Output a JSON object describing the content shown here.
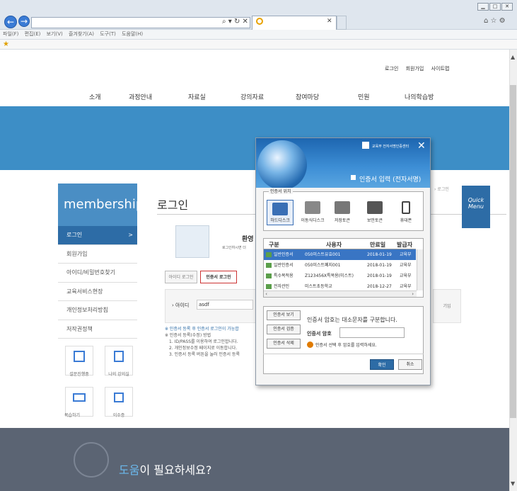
{
  "browser": {
    "menu": [
      "파일(F)",
      "편집(E)",
      "보기(V)",
      "즐겨찾기(A)",
      "도구(T)",
      "도움말(H)"
    ],
    "addr_tools": "⌕ ▾ ↻ ✕"
  },
  "header": {
    "links": [
      "로그인",
      "회원가입",
      "사이트맵"
    ],
    "nav": [
      "소개",
      "과정안내",
      "자료실",
      "강의자료",
      "참여마당",
      "민원",
      "나의학습방"
    ]
  },
  "sidebar": {
    "title": "membership",
    "items": [
      {
        "label": "로그인",
        "arrow": ">"
      },
      {
        "label": "회원가입"
      },
      {
        "label": "아이디/비밀번호찾기"
      },
      {
        "label": "교육서비스현장"
      },
      {
        "label": "개인정보처리방침"
      },
      {
        "label": "저작권정책"
      }
    ],
    "icons": [
      {
        "label": "설문진행중",
        "icon": "survey-icon"
      },
      {
        "label": "나의 강의실",
        "icon": "classroom-icon"
      },
      {
        "label": "복습하기",
        "icon": "review-icon"
      },
      {
        "label": "이수증",
        "icon": "certificate-icon"
      }
    ]
  },
  "main": {
    "title": "로그인",
    "crumb": "› 로그인",
    "welcome": "환영",
    "welcome_sub": "로그인하시면 더",
    "tabs": [
      "아이디 로그인",
      "인증서 로그인"
    ],
    "id_label": "› 아이디",
    "id_value": "asdf",
    "notes_title": "※ 인증서 등록 후 인증서 로그인이 가능합",
    "notes_head": "※ 인증서 등록(수정) 방법",
    "notes": [
      "1. ID/PASS를 이용하여 로그인합니다.",
      "2. 개인정보수정 페이지로 이동합니다.",
      "3. 인증서 등록 버튼을 눌러 인증서 등록"
    ],
    "side_text": "기입"
  },
  "quick": "Quick Menu",
  "help": {
    "highlight": "도움",
    "rest": "이 필요하세요?"
  },
  "dialog": {
    "title": "인증서 입력 (전자서명)",
    "logo_text": "교육부 전자서명인증센터",
    "close": "✕",
    "location_label": "인증서 위치",
    "locations": [
      {
        "label": "하드디스크",
        "icon": "harddisk-icon",
        "color": "#3a6fb5"
      },
      {
        "label": "이동식디스크",
        "icon": "usb-icon",
        "color": "#888888"
      },
      {
        "label": "저장토큰",
        "icon": "token-icon",
        "color": "#777777"
      },
      {
        "label": "보안토큰",
        "icon": "security-token-icon",
        "color": "#555555"
      },
      {
        "label": "휴대폰",
        "icon": "phone-icon",
        "color": "#444444"
      }
    ],
    "columns": [
      "구분",
      "사용자",
      "만료일",
      "발급자"
    ],
    "rows": [
      {
        "type": "일반인증서",
        "user": "050미스트유효001",
        "expiry": "2018-01-19",
        "issuer": "교육부"
      },
      {
        "type": "일반인증서",
        "user": "050미스트폐지001",
        "expiry": "2018-01-19",
        "issuer": "교육부"
      },
      {
        "type": "특수목적용",
        "user": "Z123456X특목용(미스트)",
        "expiry": "2018-01-19",
        "issuer": "교육부"
      },
      {
        "type": "전자관인",
        "user": "미스트초등학교",
        "expiry": "2018-12-27",
        "issuer": "교육부"
      }
    ],
    "buttons": [
      "인증서 보기",
      "인증서 검증",
      "인증서 삭제"
    ],
    "hint": "인증서 암호는 대소문자를 구분합니다.",
    "pwd_label": "인증서 암호",
    "warn": "인증서 선택 후 암호를 입력하세요.",
    "ok": "확인",
    "cancel": "취소"
  }
}
